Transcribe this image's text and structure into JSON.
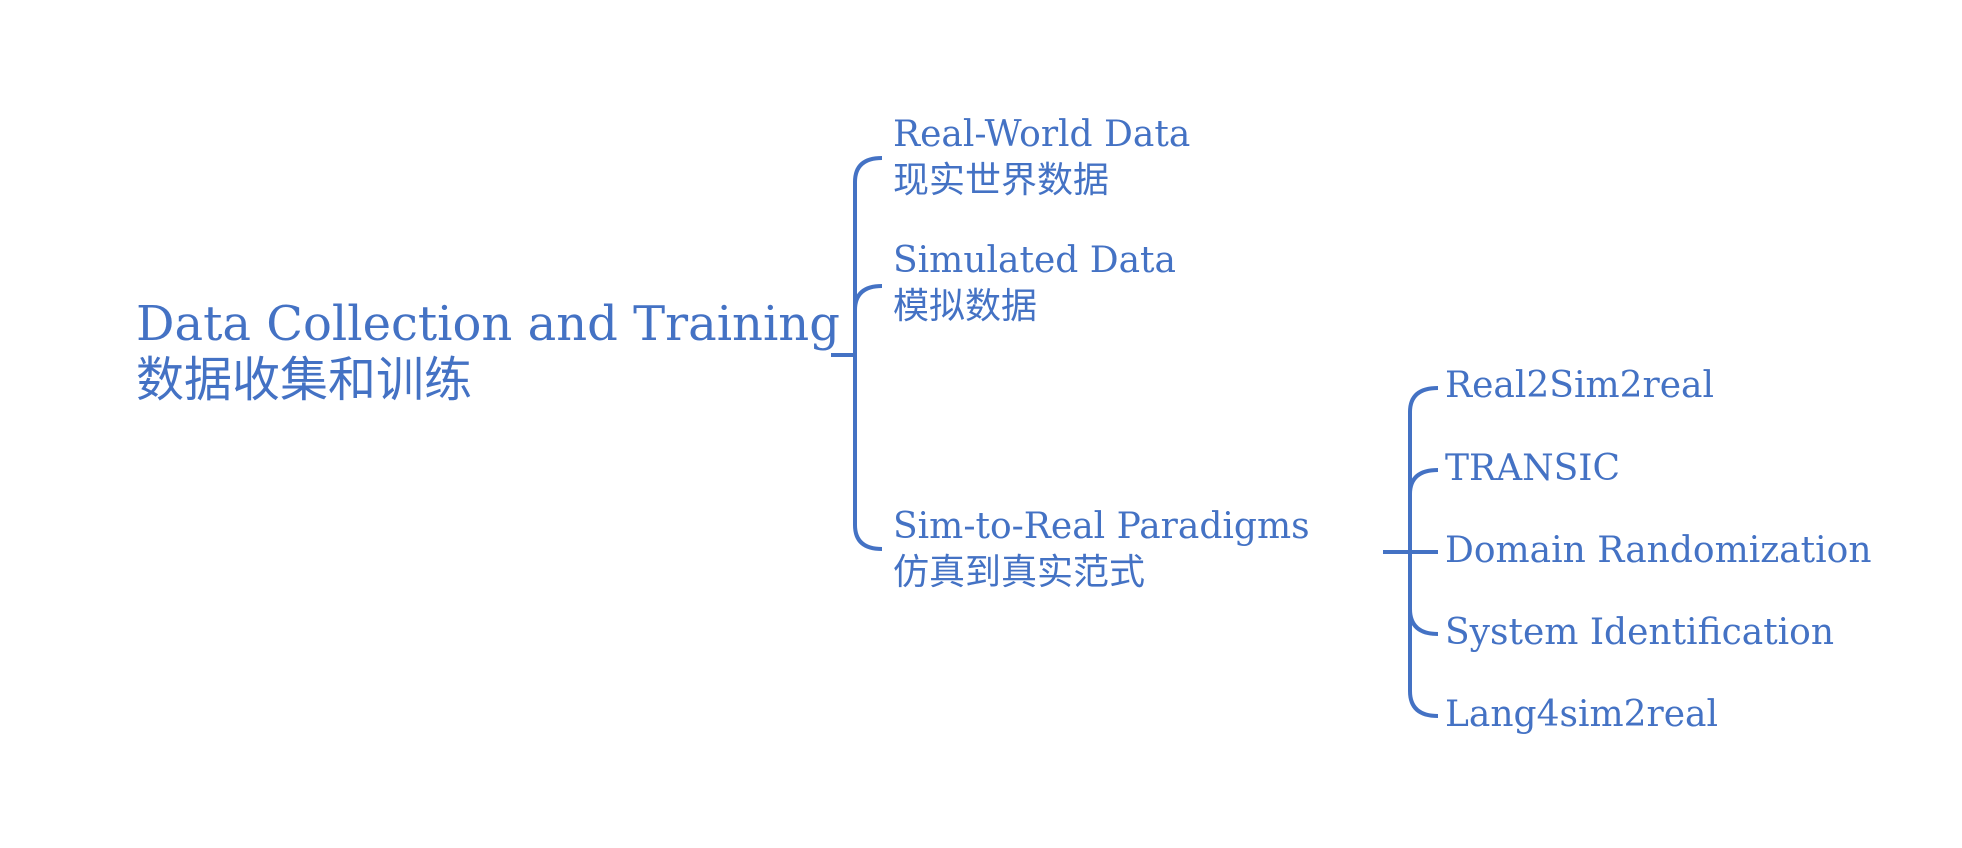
{
  "root": {
    "en": "Data Collection and Training",
    "zh": "数据收集和训练"
  },
  "branches": [
    {
      "en": "Real-World Data",
      "zh": "现实世界数据"
    },
    {
      "en": "Simulated Data",
      "zh": "模拟数据"
    },
    {
      "en": "Sim-to-Real Paradigms",
      "zh": "仿真到真实范式"
    }
  ],
  "paradigms": [
    "Real2Sim2real",
    "TRANSIC",
    "Domain Randomization",
    "System Identification",
    "Lang4sim2real"
  ],
  "colors": {
    "accent": "#4472c4",
    "background": "#ffffff"
  }
}
